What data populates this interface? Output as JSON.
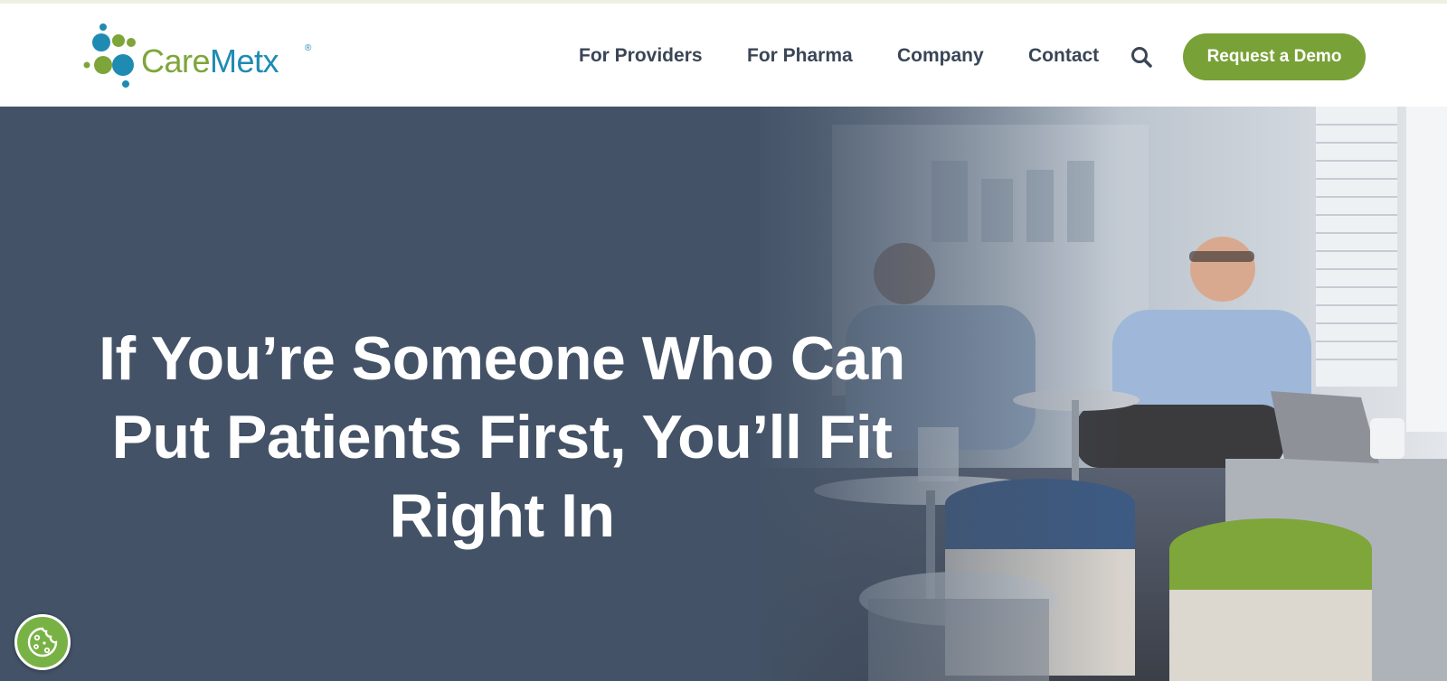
{
  "brand": {
    "name": "CareMetx",
    "name_part1": "Care",
    "name_part2": "Metx",
    "registered_mark": "®",
    "colors": {
      "blue": "#1f8bb3",
      "green": "#7ea53a"
    }
  },
  "nav": {
    "items": [
      {
        "label": "For Providers"
      },
      {
        "label": "For Pharma"
      },
      {
        "label": "Company"
      },
      {
        "label": "Contact"
      }
    ],
    "search_icon": "search-icon",
    "cta_label": "Request a Demo",
    "cta_color": "#78a137"
  },
  "hero": {
    "title_line1": "If You’re Someone Who Can",
    "title_line2": "Put Patients First, You’ll Fit",
    "title_line3": "Right In",
    "overlay_color": "#435266"
  },
  "cookie": {
    "icon": "cookie-icon",
    "color": "#78b245"
  }
}
